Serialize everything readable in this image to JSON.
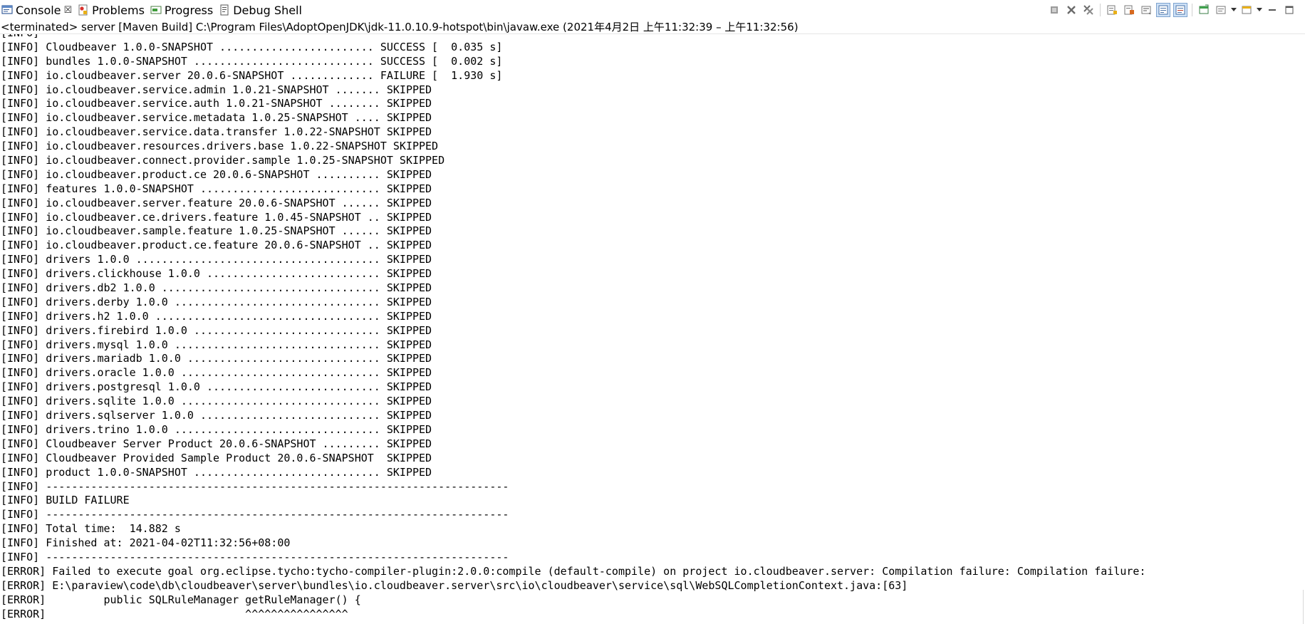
{
  "tabs": [
    {
      "label": "Console",
      "icon": "console-icon",
      "active": true,
      "close": "☒"
    },
    {
      "label": "Problems",
      "icon": "problems-icon"
    },
    {
      "label": "Progress",
      "icon": "progress-icon"
    },
    {
      "label": "Debug Shell",
      "icon": "debug-shell-icon"
    }
  ],
  "toolbar_icons": [
    "clear-icon",
    "terminate-icon",
    "remove-all-terminated-icon",
    "show-console-icon",
    "pin-console-icon",
    "word-wrap-icon",
    "scroll-lock-icon",
    "display-selected-console-icon",
    "open-console-icon",
    "minimize-icon",
    "maximize-icon"
  ],
  "status_text": "<terminated> server [Maven Build] C:\\Program Files\\AdoptOpenJDK\\jdk-11.0.10.9-hotspot\\bin\\javaw.exe  (2021年4月2日 上午11:32:39 – 上午11:32:56)",
  "console_lines": [
    "[INFO]",
    "[INFO] Cloudbeaver 1.0.0-SNAPSHOT ........................ SUCCESS [  0.035 s]",
    "[INFO] bundles 1.0.0-SNAPSHOT ............................ SUCCESS [  0.002 s]",
    "[INFO] io.cloudbeaver.server 20.0.6-SNAPSHOT ............. FAILURE [  1.930 s]",
    "[INFO] io.cloudbeaver.service.admin 1.0.21-SNAPSHOT ....... SKIPPED",
    "[INFO] io.cloudbeaver.service.auth 1.0.21-SNAPSHOT ........ SKIPPED",
    "[INFO] io.cloudbeaver.service.metadata 1.0.25-SNAPSHOT .... SKIPPED",
    "[INFO] io.cloudbeaver.service.data.transfer 1.0.22-SNAPSHOT SKIPPED",
    "[INFO] io.cloudbeaver.resources.drivers.base 1.0.22-SNAPSHOT SKIPPED",
    "[INFO] io.cloudbeaver.connect.provider.sample 1.0.25-SNAPSHOT SKIPPED",
    "[INFO] io.cloudbeaver.product.ce 20.0.6-SNAPSHOT .......... SKIPPED",
    "[INFO] features 1.0.0-SNAPSHOT ............................ SKIPPED",
    "[INFO] io.cloudbeaver.server.feature 20.0.6-SNAPSHOT ...... SKIPPED",
    "[INFO] io.cloudbeaver.ce.drivers.feature 1.0.45-SNAPSHOT .. SKIPPED",
    "[INFO] io.cloudbeaver.sample.feature 1.0.25-SNAPSHOT ...... SKIPPED",
    "[INFO] io.cloudbeaver.product.ce.feature 20.0.6-SNAPSHOT .. SKIPPED",
    "[INFO] drivers 1.0.0 ...................................... SKIPPED",
    "[INFO] drivers.clickhouse 1.0.0 ........................... SKIPPED",
    "[INFO] drivers.db2 1.0.0 .................................. SKIPPED",
    "[INFO] drivers.derby 1.0.0 ................................ SKIPPED",
    "[INFO] drivers.h2 1.0.0 ................................... SKIPPED",
    "[INFO] drivers.firebird 1.0.0 ............................. SKIPPED",
    "[INFO] drivers.mysql 1.0.0 ................................ SKIPPED",
    "[INFO] drivers.mariadb 1.0.0 .............................. SKIPPED",
    "[INFO] drivers.oracle 1.0.0 ............................... SKIPPED",
    "[INFO] drivers.postgresql 1.0.0 ........................... SKIPPED",
    "[INFO] drivers.sqlite 1.0.0 ............................... SKIPPED",
    "[INFO] drivers.sqlserver 1.0.0 ............................ SKIPPED",
    "[INFO] drivers.trino 1.0.0 ................................ SKIPPED",
    "[INFO] Cloudbeaver Server Product 20.0.6-SNAPSHOT ......... SKIPPED",
    "[INFO] Cloudbeaver Provided Sample Product 20.0.6-SNAPSHOT  SKIPPED",
    "[INFO] product 1.0.0-SNAPSHOT ............................. SKIPPED",
    "[INFO] ------------------------------------------------------------------------",
    "[INFO] BUILD FAILURE",
    "[INFO] ------------------------------------------------------------------------",
    "[INFO] Total time:  14.882 s",
    "[INFO] Finished at: 2021-04-02T11:32:56+08:00",
    "[INFO] ------------------------------------------------------------------------",
    "[ERROR] Failed to execute goal org.eclipse.tycho:tycho-compiler-plugin:2.0.0:compile (default-compile) on project io.cloudbeaver.server: Compilation failure: Compilation failure:",
    "[ERROR] E:\\paraview\\code\\db\\cloudbeaver\\server\\bundles\\io.cloudbeaver.server\\src\\io\\cloudbeaver\\service\\sql\\WebSQLCompletionContext.java:[63]",
    "[ERROR]         public SQLRuleManager getRuleManager() {",
    "[ERROR]                               ^^^^^^^^^^^^^^^^"
  ]
}
